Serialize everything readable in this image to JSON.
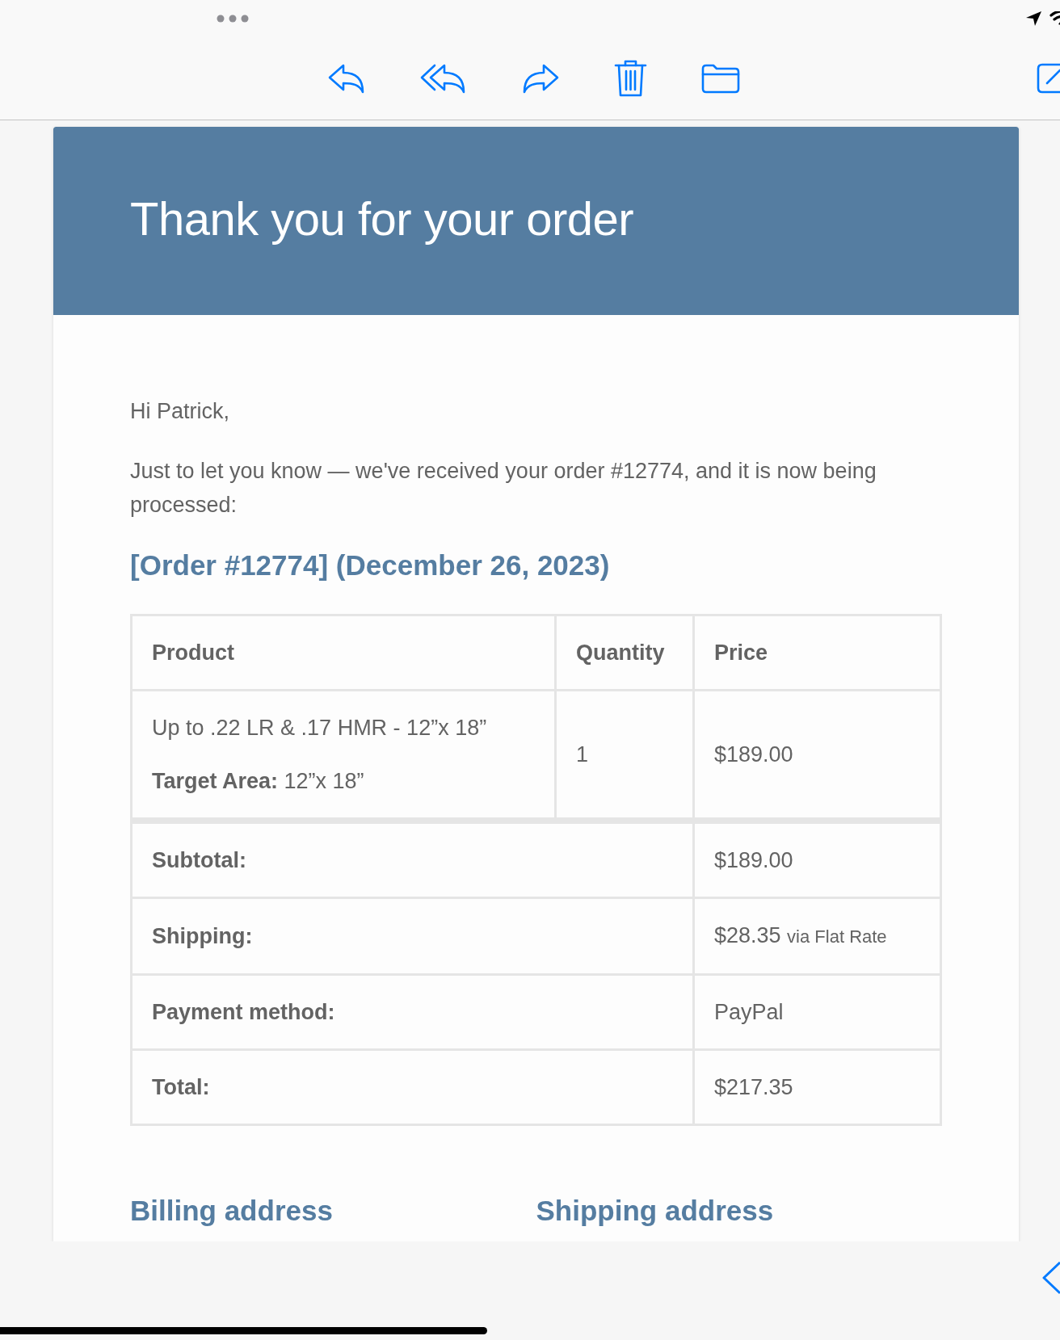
{
  "email": {
    "header": {
      "title": "Thank you for your order"
    },
    "greeting": "Hi Patrick,",
    "intro": "Just to let you know — we've received your order #12774, and it is now being processed:",
    "order_heading": "[Order #12774] (December 26, 2023)",
    "order_table": {
      "columns": [
        "Product",
        "Quantity",
        "Price"
      ],
      "items": [
        {
          "product": "Up to .22 LR & .17 HMR - 12”x 18”",
          "meta": "**Target Area:** 12”x 18”",
          "quantity": "1",
          "price": "$189.00"
        }
      ],
      "totals": [
        {
          "label": "Subtotal:",
          "value": "$189.00"
        },
        {
          "label": "Shipping:",
          "value": "$28.35",
          "note": "via Flat Rate"
        },
        {
          "label": "Payment method:",
          "value": "PayPal"
        },
        {
          "label": "Total:",
          "value": "$217.35"
        }
      ]
    },
    "address_headings": [
      "Billing address",
      "Shipping address"
    ]
  }
}
